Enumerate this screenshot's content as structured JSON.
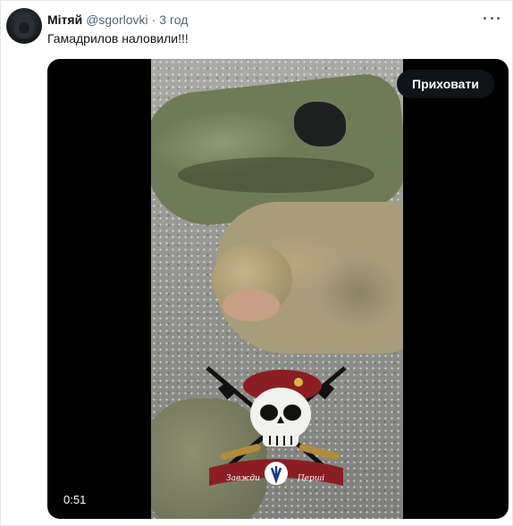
{
  "tweet": {
    "author_name": "Мітяй",
    "author_handle": "@sgorlovki",
    "separator": "·",
    "time": "3 год",
    "text": "Гамадрилов наловили!!!",
    "more_icon": "more-horizontal-icon"
  },
  "media": {
    "hide_button_label": "Приховати",
    "duration": "0:51",
    "emblem_banner_text": "ЗАВЖДИ ПЕРШІ"
  },
  "colors": {
    "text_primary": "#0f1419",
    "text_secondary": "#536471",
    "button_bg": "#0f1419",
    "beret": "#8b1e24"
  }
}
